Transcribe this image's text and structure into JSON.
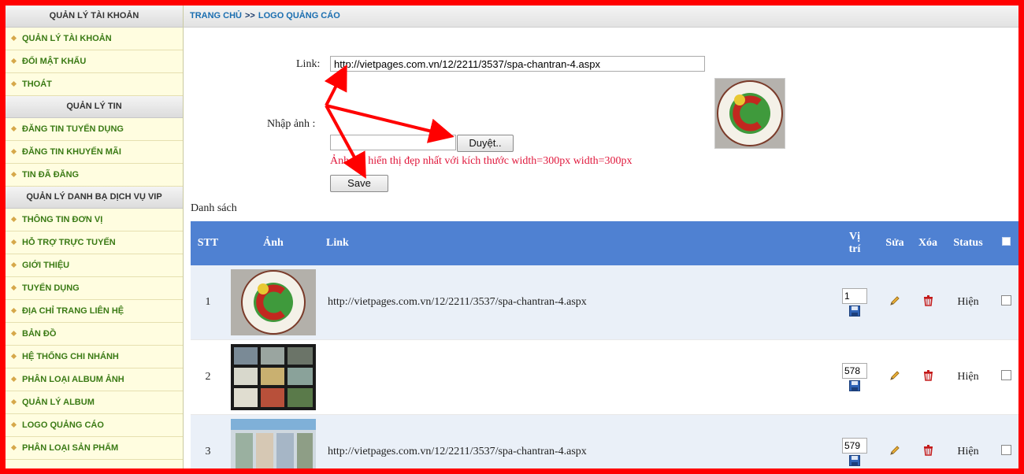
{
  "sidebar": {
    "sections": [
      {
        "title": "QUẢN LÝ TÀI KHOẢN",
        "items": [
          "QUẢN LÝ TÀI KHOẢN",
          "ĐỔI MẬT KHẨU",
          "THOÁT"
        ]
      },
      {
        "title": "QUẢN LÝ TIN",
        "items": [
          "ĐĂNG TIN TUYỂN DỤNG",
          "ĐĂNG TIN KHUYẾN MÃI",
          "TIN ĐÃ ĐĂNG"
        ]
      },
      {
        "title": "QUẢN LÝ DANH BẠ DỊCH VỤ VIP",
        "items": [
          "THÔNG TIN ĐƠN VỊ",
          "HỖ TRỢ TRỰC TUYẾN",
          "GIỚI THIỆU",
          "TUYỂN DỤNG",
          "ĐỊA CHỈ TRANG LIÊN HỆ",
          "BẢN ĐỒ",
          "HỆ THỐNG CHI NHÁNH",
          "PHÂN LOẠI ALBUM ẢNH",
          "QUẢN LÝ ALBUM",
          "LOGO QUẢNG CÁO",
          "PHÂN LOẠI SẢN PHẨM"
        ]
      }
    ]
  },
  "breadcrumb": {
    "home": "TRANG CHỦ",
    "separator": ">>",
    "current": "LOGO QUẢNG CÁO"
  },
  "form": {
    "link_label": "Link:",
    "link_value": "http://vietpages.com.vn/12/2211/3537/spa-chantran-4.aspx",
    "image_label": "Nhập ảnh :",
    "browse_label": "Duyệt..",
    "hint": "Ảnh chỉ hiển thị đẹp nhất với kích thước width=300px width=300px",
    "save_label": "Save"
  },
  "list": {
    "title": "Danh sách",
    "headers": {
      "stt": "STT",
      "image": "Ảnh",
      "link": "Link",
      "position_line1": "Vị",
      "position_line2": "trí",
      "edit": "Sửa",
      "delete": "Xóa",
      "status": "Status"
    },
    "rows": [
      {
        "stt": "1",
        "link": "http://vietpages.com.vn/12/2211/3537/spa-chantran-4.aspx",
        "position": "1",
        "status": "Hiện",
        "image": "spa-logo"
      },
      {
        "stt": "2",
        "link": "",
        "position": "578",
        "status": "Hiện",
        "image": "cosmetics-shelf"
      },
      {
        "stt": "3",
        "link": "http://vietpages.com.vn/12/2211/3537/spa-chantran-4.aspx",
        "position": "579",
        "status": "Hiện",
        "image": "store-front"
      }
    ]
  },
  "colors": {
    "frame": "#ff0000",
    "table_header": "#4f81d2",
    "breadcrumb": "#1a6eb0",
    "sidebar_item": "#3a7a14",
    "hint": "#e0183c",
    "annotation_arrow": "#ff0000"
  },
  "icons": {
    "edit": "pencil-icon",
    "delete": "trash-icon",
    "save_position": "floppy-disk-icon",
    "sidebar_bullet": "diamond-bullet-icon"
  }
}
